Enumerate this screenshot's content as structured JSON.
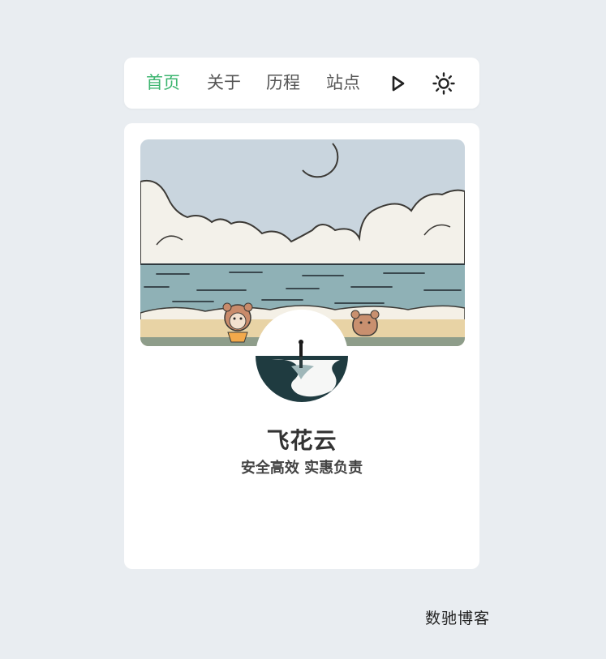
{
  "nav": {
    "items": [
      {
        "label": "首页",
        "active": true
      },
      {
        "label": "关于",
        "active": false
      },
      {
        "label": "历程",
        "active": false
      },
      {
        "label": "站点",
        "active": false
      }
    ],
    "icons": [
      "play-icon",
      "sun-icon"
    ],
    "active_color": "#3cb56f"
  },
  "profile": {
    "name": "飞花云",
    "slogan": "安全高效 实惠负责"
  },
  "watermark": "数驰博客",
  "colors": {
    "background": "#e9edf1",
    "card": "#ffffff",
    "text": "#333333"
  }
}
